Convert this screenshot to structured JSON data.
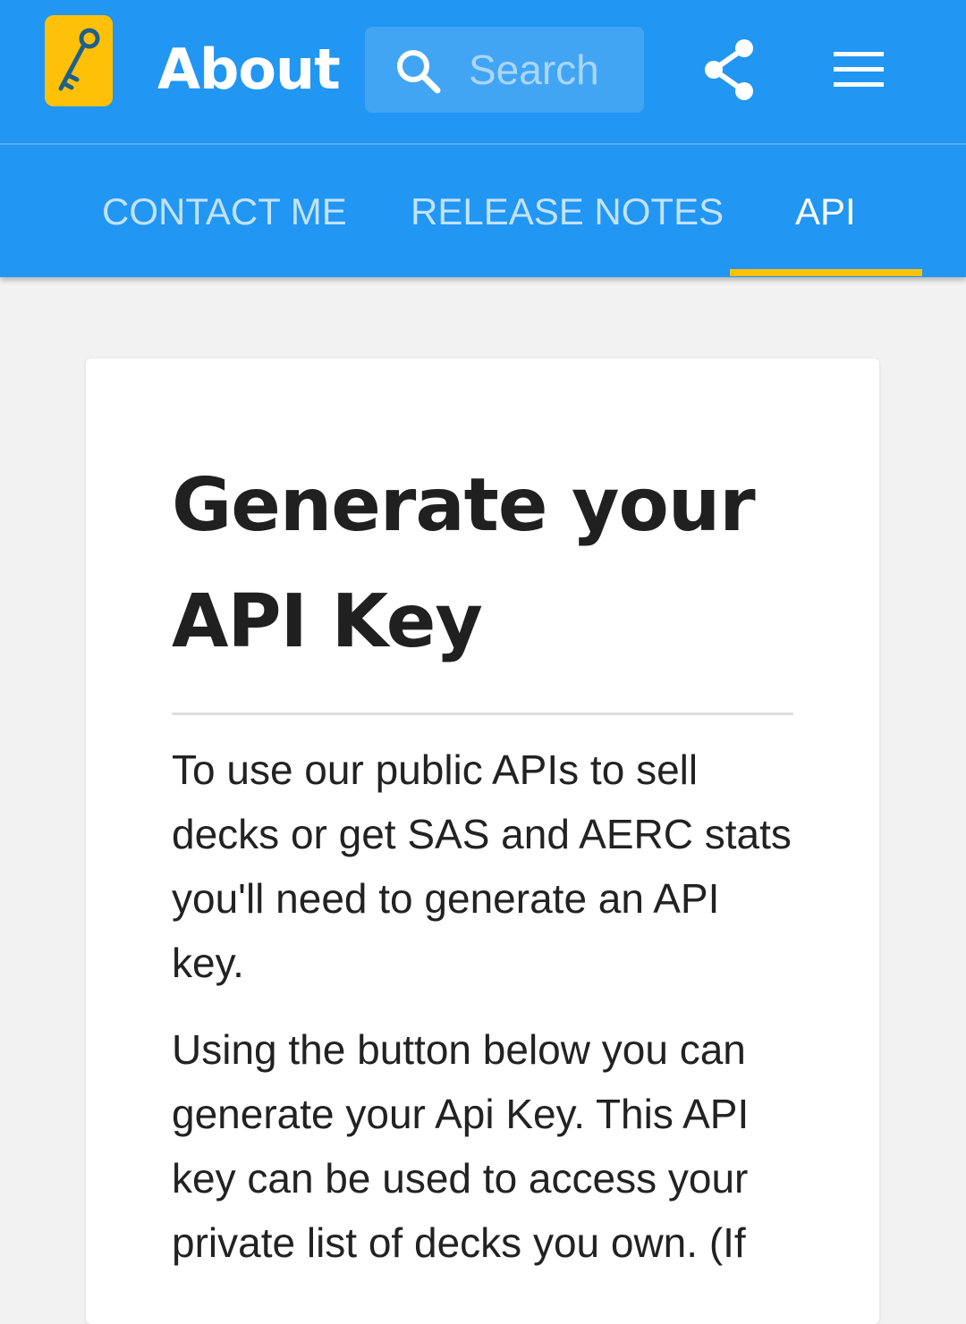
{
  "header": {
    "title": "About",
    "search": {
      "placeholder": "Search",
      "value": ""
    },
    "logo_icon": "key-icon",
    "share_icon": "share-icon",
    "menu_icon": "menu-icon",
    "colors": {
      "appbar": "#2196f3",
      "logo_bg": "#ffc107",
      "tab_indicator": "#ffc107"
    }
  },
  "tabs": [
    {
      "label": "CONTACT ME",
      "active": false
    },
    {
      "label": "RELEASE NOTES",
      "active": false
    },
    {
      "label": "API",
      "active": true
    }
  ],
  "card": {
    "title": "Generate your API Key",
    "paragraphs": [
      "To use our public APIs to sell decks or get SAS and AERC stats you'll need to generate an API key.",
      "Using the button below you can generate your Api Key. This API key can be used to access your private list of decks you own. (If"
    ]
  }
}
